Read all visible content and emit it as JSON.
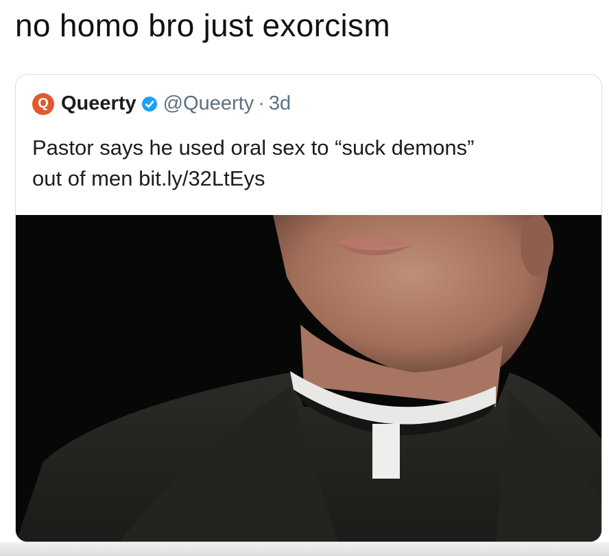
{
  "caption": "no homo bro just exorcism",
  "tweet": {
    "avatar_letter": "Q",
    "display_name": "Queerty",
    "handle": "@Queerty",
    "separator": "·",
    "time": "3d",
    "text_line1": "Pastor says he used oral sex to “suck demons”",
    "text_line2": "out of men bit.ly/32LtEys",
    "verified_color": "#1da1f2",
    "avatar_color": "#e4572e"
  },
  "icons": {
    "avatar": "queerty-logo-icon",
    "verified": "verified-badge-icon"
  }
}
